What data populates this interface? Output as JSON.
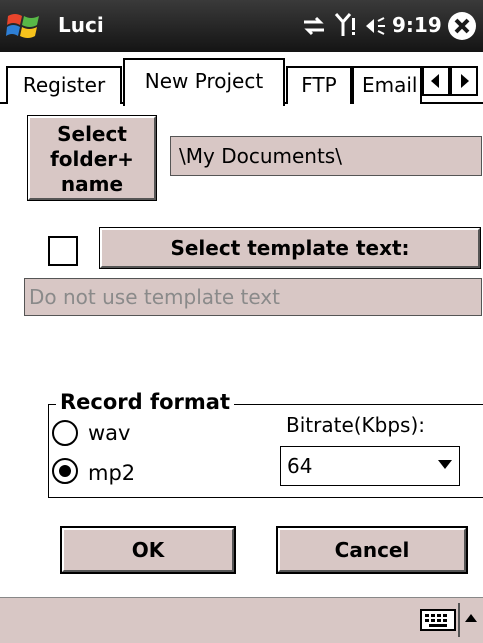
{
  "titlebar": {
    "app_title": "Luci",
    "time": "9:19"
  },
  "tabs": [
    {
      "label": "Register",
      "selected": false
    },
    {
      "label": "New Project",
      "selected": true
    },
    {
      "label": "FTP",
      "selected": false
    },
    {
      "label": "Email",
      "selected": false
    }
  ],
  "project": {
    "select_folder_label_line1": "Select",
    "select_folder_label_line2": "folder+",
    "select_folder_label_line3": "name",
    "folder_value": "\\My Documents\\",
    "template_checked": false,
    "select_template_label": "Select template text:",
    "template_value": "Do not use template text"
  },
  "record_format": {
    "title": "Record format",
    "options": [
      {
        "label": "wav",
        "selected": false
      },
      {
        "label": "mp2",
        "selected": true
      }
    ],
    "bitrate_label": "Bitrate(Kbps):",
    "bitrate_value": "64"
  },
  "buttons": {
    "ok": "OK",
    "cancel": "Cancel"
  },
  "colors": {
    "control_bg": "#d8c7c5",
    "titlebar_bg": "#1a1a1a"
  }
}
